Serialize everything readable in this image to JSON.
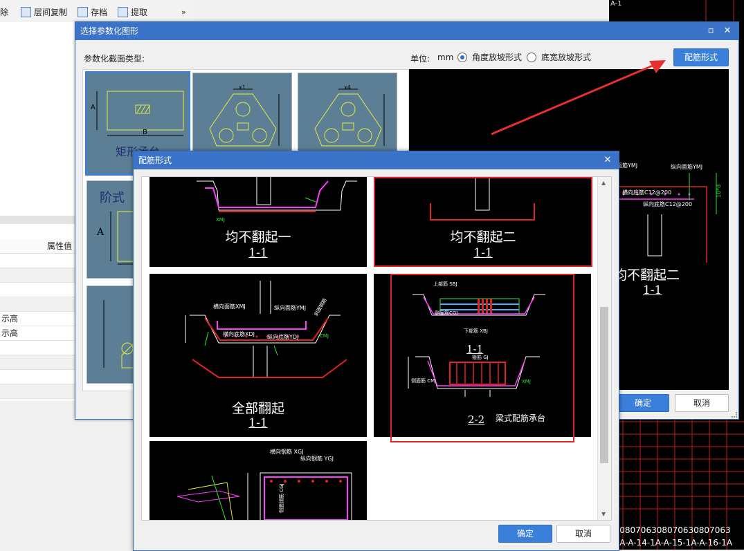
{
  "toolbar": {
    "delete_label": "除",
    "copy_floor_label": "层间复制",
    "save_label": "存档",
    "extract_label": "提取",
    "more_label": "»"
  },
  "left_panel": {
    "attr_header": "属性值",
    "row_a": "示高",
    "row_b": "示高"
  },
  "cad": {
    "top_label": "A-1",
    "bottom_row1": "63080706308070630807063",
    "bottom_row2": "11A-A-14-1A-A-15-1A-A-16-1A"
  },
  "dialog_main": {
    "title": "选择参数化图形",
    "section_type_label": "参数化截面类型:",
    "unit_label": "单位:",
    "unit_value": "mm",
    "radio_angle_label": "角度放坡形式",
    "radio_width_label": "底宽放坡形式",
    "rebar_button": "配筋形式",
    "confirm_button": "确定",
    "cancel_button": "取消",
    "thumbs": {
      "rect_caption": "矩形承台",
      "rect_dim_a": "A",
      "rect_dim_b": "B",
      "step_caption": "阶式",
      "step_dim_a": "A",
      "tri_dim_x1": "x1",
      "tri_dim_x4": "x4"
    },
    "preview": {
      "label_top_rebar": "面筋YMJ",
      "label_long_top": "纵向面筋YMJ",
      "label_cross_bottom": "横向底筋C12@200",
      "label_long_bottom": "纵向底筋C12@200",
      "label_ref": "10*d",
      "caption": "均不翻起二",
      "section": "1-1"
    }
  },
  "dialog_rebar": {
    "title": "配筋形式",
    "confirm_button": "确定",
    "cancel_button": "取消",
    "panels": [
      {
        "caption": "均不翻起一",
        "section": "1-1",
        "label_a": "XMJ"
      },
      {
        "caption": "均不翻起二",
        "section": "1-1"
      },
      {
        "caption": "全部翻起",
        "section": "1-1",
        "label_top_cross": "横向面筋XMJ",
        "label_top_long": "纵向面筋YMJ",
        "label_bot_cross": "横向底筋XDJ",
        "label_bot_long": "纵向底筋YDJ",
        "label_side": "CMJ",
        "label_slope": "斜面钢筋"
      },
      {
        "caption": "梁式配筋承台",
        "section_a": "1-1",
        "section_b": "2-2",
        "label_top": "上部筋 SBJ",
        "label_side_face": "侧面筋CGJ",
        "label_bot": "下部筋 XBJ",
        "label_hoop": "箍筋 GJ",
        "label_side2": "侧面筋 CMJ",
        "label_xmj": "XMJ"
      },
      {
        "label_cross": "横向钢筋 XGJ",
        "label_long": "纵向钢筋 YGJ",
        "label_side": "侧面钢筋 CGJ"
      }
    ]
  },
  "colors": {
    "title_bar": "#3a73c7",
    "accent_red": "#e02424",
    "thumb_bg": "#5d7f95"
  }
}
